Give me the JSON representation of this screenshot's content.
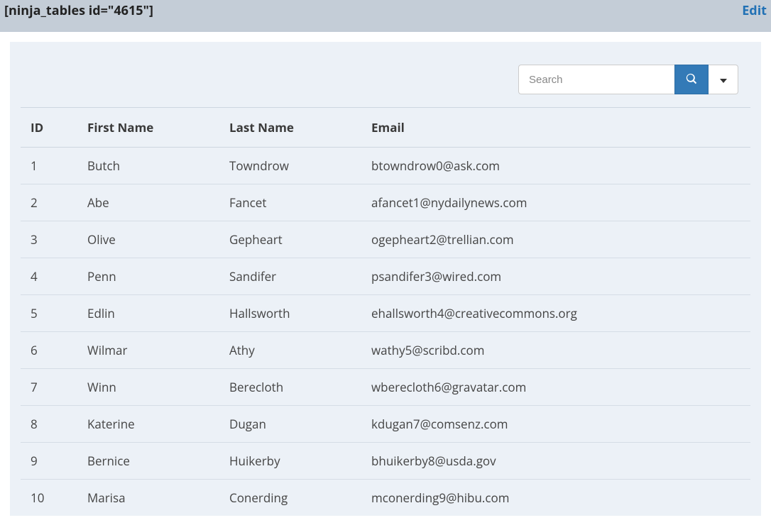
{
  "header": {
    "shortcode": "[ninja_tables id=\"4615\"]",
    "edit": "Edit"
  },
  "search": {
    "placeholder": "Search"
  },
  "columns": {
    "id": "ID",
    "first_name": "First Name",
    "last_name": "Last Name",
    "email": "Email"
  },
  "rows": [
    {
      "id": "1",
      "first_name": "Butch",
      "last_name": "Towndrow",
      "email": "btowndrow0@ask.com"
    },
    {
      "id": "2",
      "first_name": "Abe",
      "last_name": "Fancet",
      "email": "afancet1@nydailynews.com"
    },
    {
      "id": "3",
      "first_name": "Olive",
      "last_name": "Gepheart",
      "email": "ogepheart2@trellian.com"
    },
    {
      "id": "4",
      "first_name": "Penn",
      "last_name": "Sandifer",
      "email": "psandifer3@wired.com"
    },
    {
      "id": "5",
      "first_name": "Edlin",
      "last_name": "Hallsworth",
      "email": "ehallsworth4@creativecommons.org"
    },
    {
      "id": "6",
      "first_name": "Wilmar",
      "last_name": "Athy",
      "email": "wathy5@scribd.com"
    },
    {
      "id": "7",
      "first_name": "Winn",
      "last_name": "Berecloth",
      "email": "wberecloth6@gravatar.com"
    },
    {
      "id": "8",
      "first_name": "Katerine",
      "last_name": "Dugan",
      "email": "kdugan7@comsenz.com"
    },
    {
      "id": "9",
      "first_name": "Bernice",
      "last_name": "Huikerby",
      "email": "bhuikerby8@usda.gov"
    },
    {
      "id": "10",
      "first_name": "Marisa",
      "last_name": "Conerding",
      "email": "mconerding9@hibu.com"
    }
  ]
}
